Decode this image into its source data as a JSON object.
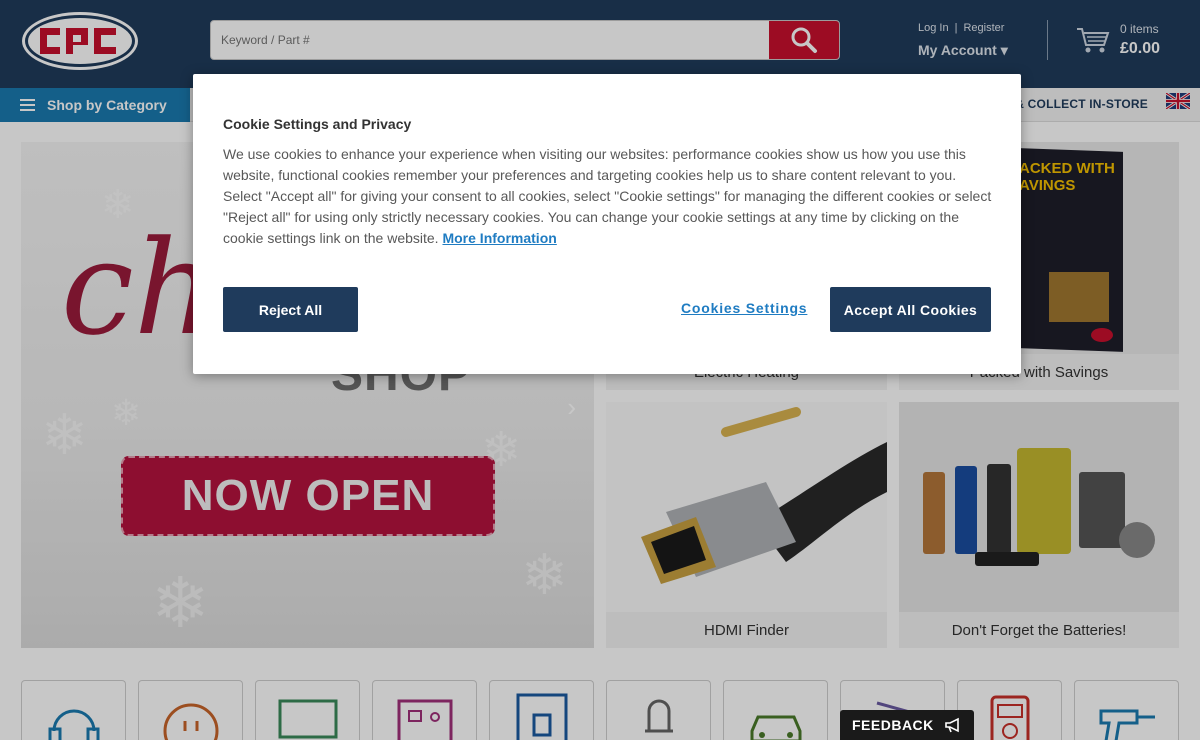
{
  "header": {
    "logo_text": "cpc",
    "search": {
      "placeholder": "Keyword / Part #"
    },
    "account": {
      "login": "Log In",
      "sep": "|",
      "register": "Register",
      "my_account": "My Account ▾"
    },
    "cart": {
      "items": "0 items",
      "total": "£0.00"
    }
  },
  "nav": {
    "shop_by_category": "Shop by Category",
    "collect": "K & COLLECT IN-STORE"
  },
  "hero": {
    "script_text": "ch",
    "shop_text": "SHOP",
    "badge_text": "NOW OPEN",
    "next_arrow": "›"
  },
  "tiles": {
    "heating": "Electric Heating",
    "packed": "Packed with Savings",
    "packed_cover_text": "ACKED WITH\nAVINGS",
    "hdmi": "HDMI Finder",
    "batteries": "Don't Forget the Batteries!"
  },
  "cookie": {
    "title": "Cookie Settings and Privacy",
    "body": "We use cookies to enhance your experience when visiting our websites: performance cookies show us how you use this website, functional cookies remember your preferences and targeting cookies help us to share content relevant to you. Select \"Accept all\" for giving your consent to all cookies, select \"Cookie settings\" for managing the different cookies or select \"Reject all\" for using only strictly necessary cookies. You can change your cookie settings at any time by clicking on the cookie settings link on the website.",
    "more_info": "More Information",
    "reject": "Reject All",
    "settings": "Cookies Settings",
    "accept": "Accept All Cookies"
  },
  "feedback": {
    "label": "FEEDBACK"
  },
  "colors": {
    "header_bg": "#1f3b5c",
    "search_btn": "#c8102e",
    "nav_blue": "#1a7ab0",
    "brand_red": "#b5123e",
    "button_navy": "#1f3b5c",
    "link_blue": "#1f7cc2"
  },
  "icons": {
    "category_icons": [
      "headphones-icon",
      "plug-icon",
      "monitor-icon",
      "circuit-board-icon",
      "socket-icon",
      "led-icon",
      "car-icon",
      "tools-icon",
      "multimeter-icon",
      "drill-icon"
    ]
  }
}
